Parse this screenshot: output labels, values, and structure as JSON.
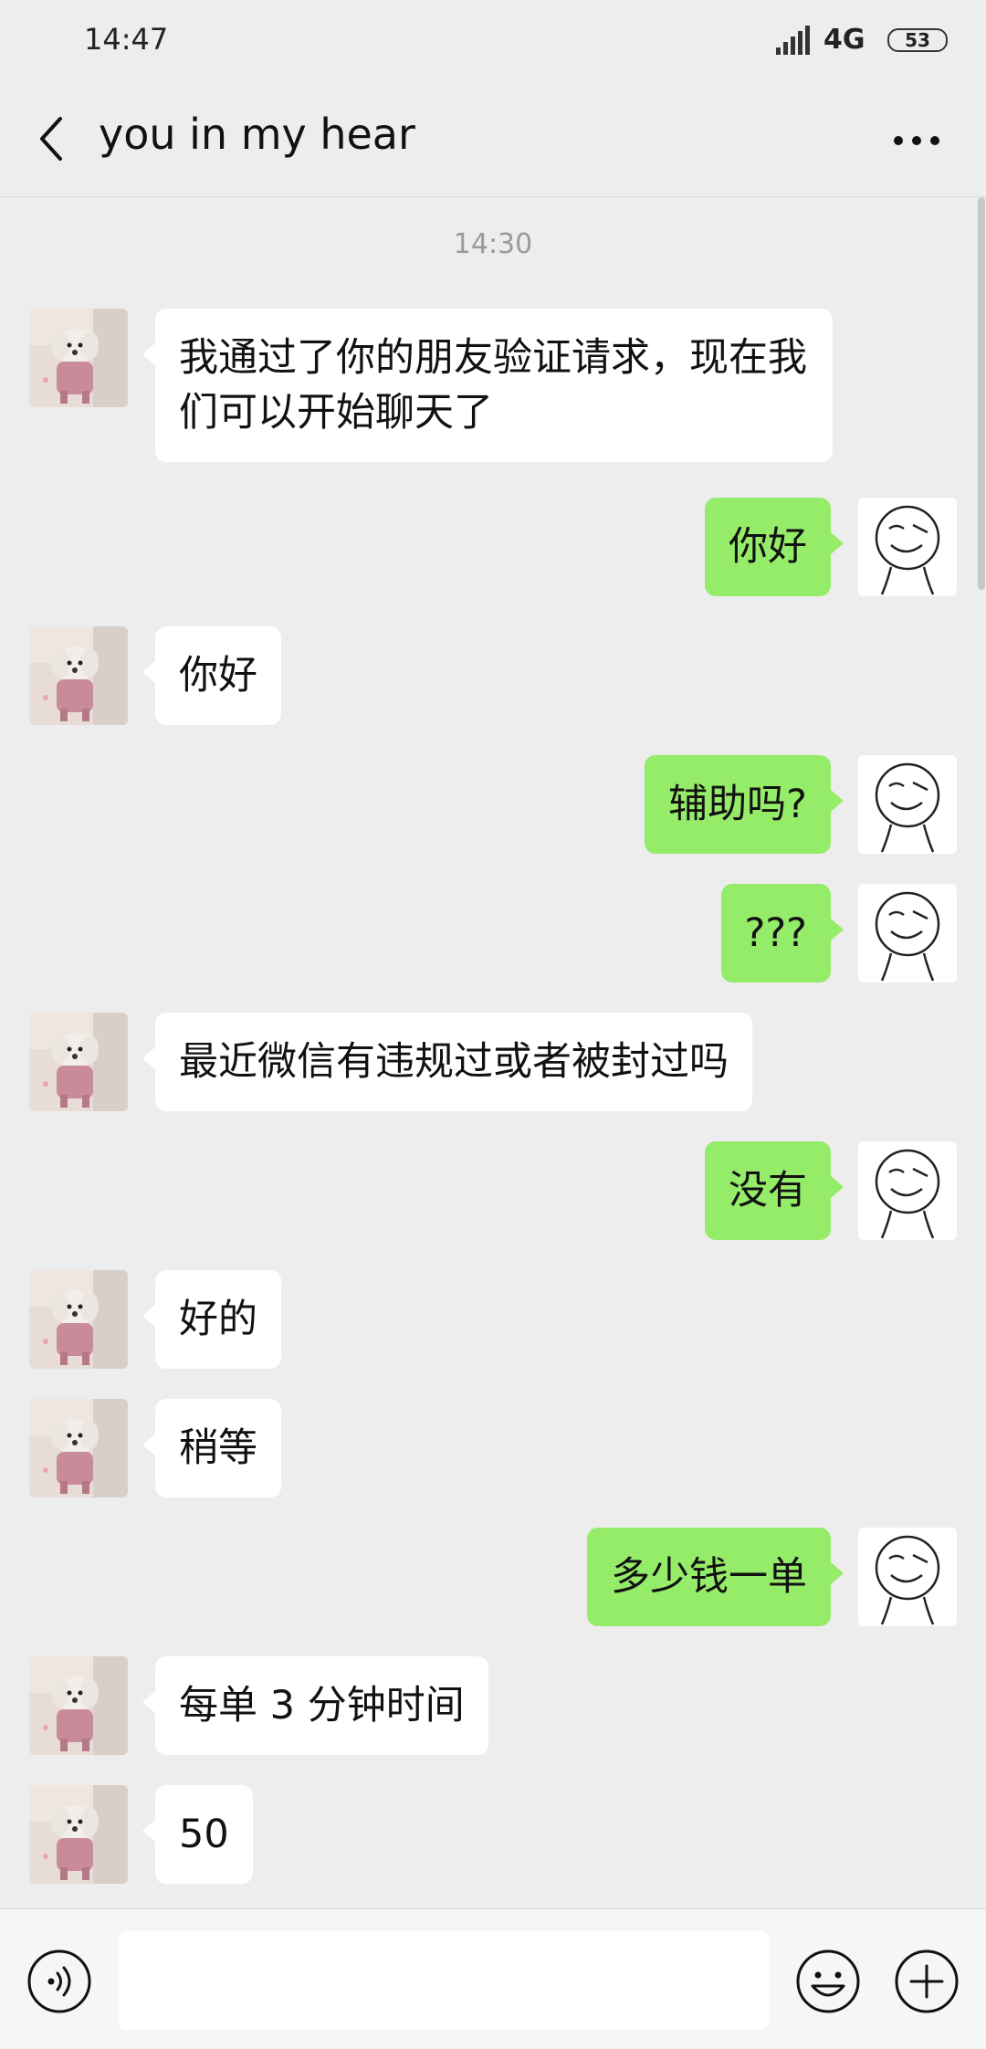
{
  "status_bar": {
    "time": "14:47",
    "network": "4G",
    "battery": "53"
  },
  "header": {
    "title": "you in my hear"
  },
  "chat": {
    "timestamp": "14:30",
    "messages": [
      {
        "side": "in",
        "text": "我通过了你的朋友验证请求，现在我们可以开始聊天了"
      },
      {
        "side": "out",
        "text": "你好"
      },
      {
        "side": "in",
        "text": "你好"
      },
      {
        "side": "out",
        "text": "辅助吗?"
      },
      {
        "side": "out",
        "text": "???"
      },
      {
        "side": "in",
        "text": "最近微信有违规过或者被封过吗"
      },
      {
        "side": "out",
        "text": "没有"
      },
      {
        "side": "in",
        "text": "好的"
      },
      {
        "side": "in",
        "text": "稍等"
      },
      {
        "side": "out",
        "text": "多少钱一单"
      },
      {
        "side": "in",
        "text": "每单 3 分钟时间"
      },
      {
        "side": "in",
        "text": "50"
      }
    ]
  },
  "input_bar": {
    "value": ""
  },
  "icons": {
    "back": "chevron-left-icon",
    "more": "more-horizontal-icon",
    "voice": "voice-icon",
    "emoji": "emoji-icon",
    "plus": "plus-icon"
  },
  "colors": {
    "outgoing_bubble": "#95ec69",
    "incoming_bubble": "#ffffff",
    "background": "#ededed"
  }
}
